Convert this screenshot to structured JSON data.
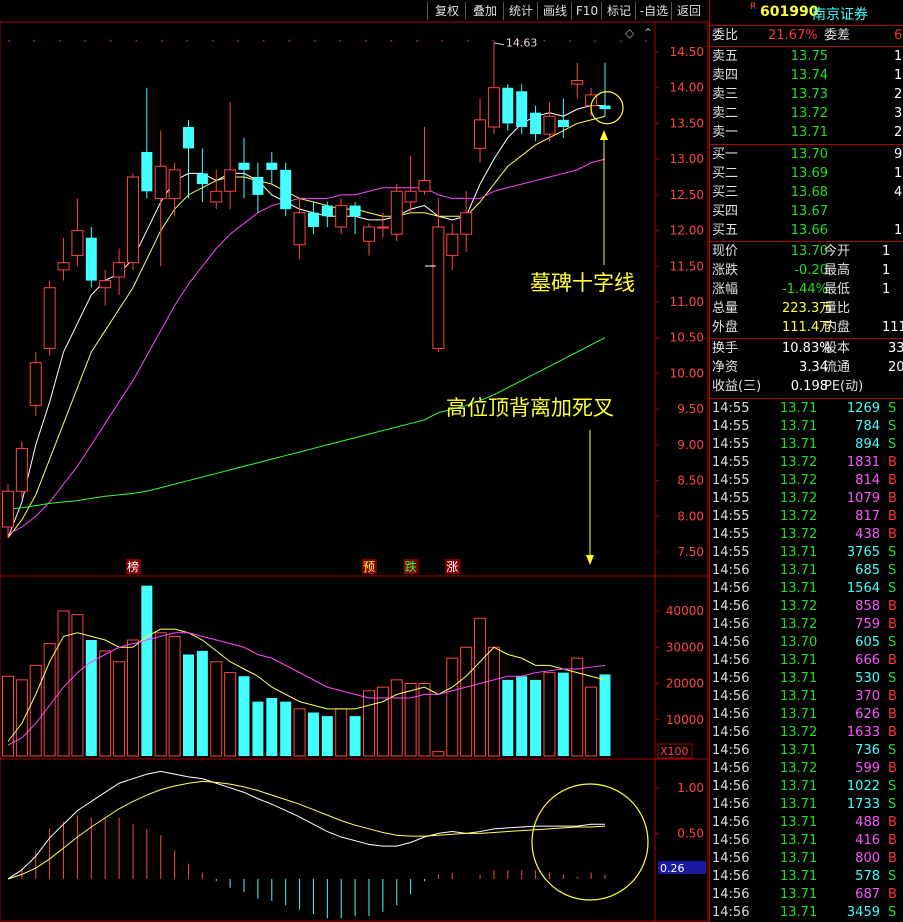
{
  "toolbar": {
    "buttons": [
      "复权",
      "叠加",
      "统计",
      "画线",
      "F10",
      "标记",
      "-自选",
      "返回"
    ]
  },
  "stock": {
    "badge": "R",
    "code": "601990",
    "name": "南京证券"
  },
  "orderbook": {
    "weibi_label": "委比",
    "weibi_value": "21.67%",
    "weicha_label": "委差",
    "weicha_value": "6",
    "asks": [
      {
        "label": "卖五",
        "price": "13.75",
        "vol": "1"
      },
      {
        "label": "卖四",
        "price": "13.74",
        "vol": "1"
      },
      {
        "label": "卖三",
        "price": "13.73",
        "vol": "2"
      },
      {
        "label": "卖二",
        "price": "13.72",
        "vol": "3"
      },
      {
        "label": "卖一",
        "price": "13.71",
        "vol": "2"
      }
    ],
    "bids": [
      {
        "label": "买一",
        "price": "13.70",
        "vol": "9"
      },
      {
        "label": "买二",
        "price": "13.69",
        "vol": "1"
      },
      {
        "label": "买三",
        "price": "13.68",
        "vol": "4"
      },
      {
        "label": "买四",
        "price": "13.67",
        "vol": ""
      },
      {
        "label": "买五",
        "price": "13.66",
        "vol": "1"
      }
    ]
  },
  "quote": [
    {
      "l1": "现价",
      "v1": "13.70",
      "l2": "今开",
      "v2": "1"
    },
    {
      "l1": "涨跌",
      "v1": "-0.20",
      "l2": "最高",
      "v2": "1"
    },
    {
      "l1": "涨幅",
      "v1": "-1.44%",
      "l2": "最低",
      "v2": "1"
    },
    {
      "l1": "总量",
      "v1": "223.3万",
      "l2": "量比",
      "v2": ""
    },
    {
      "l1": "外盘",
      "v1": "111.4万",
      "l2": "内盘",
      "v2": "111"
    }
  ],
  "fund": [
    {
      "l1": "换手",
      "v1": "10.83%",
      "l2": "股本",
      "v2": "33"
    },
    {
      "l1": "净资",
      "v1": "3.34",
      "l2": "流通",
      "v2": "20"
    },
    {
      "l1": "收益(三)",
      "v1": "0.198",
      "l2": "PE(动)",
      "v2": ""
    }
  ],
  "ticks": [
    [
      "14:55",
      "13.71",
      "1269",
      "S"
    ],
    [
      "14:55",
      "13.71",
      "784",
      "S"
    ],
    [
      "14:55",
      "13.71",
      "894",
      "S"
    ],
    [
      "14:55",
      "13.72",
      "1831",
      "B"
    ],
    [
      "14:55",
      "13.72",
      "814",
      "B"
    ],
    [
      "14:55",
      "13.72",
      "1079",
      "B"
    ],
    [
      "14:55",
      "13.72",
      "817",
      "B"
    ],
    [
      "14:55",
      "13.72",
      "438",
      "B"
    ],
    [
      "14:55",
      "13.71",
      "3765",
      "S"
    ],
    [
      "14:56",
      "13.71",
      "685",
      "S"
    ],
    [
      "14:56",
      "13.71",
      "1564",
      "S"
    ],
    [
      "14:56",
      "13.72",
      "858",
      "B"
    ],
    [
      "14:56",
      "13.72",
      "759",
      "B"
    ],
    [
      "14:56",
      "13.70",
      "605",
      "S"
    ],
    [
      "14:56",
      "13.71",
      "666",
      "B"
    ],
    [
      "14:56",
      "13.71",
      "530",
      "S"
    ],
    [
      "14:56",
      "13.71",
      "370",
      "B"
    ],
    [
      "14:56",
      "13.71",
      "626",
      "B"
    ],
    [
      "14:56",
      "13.72",
      "1633",
      "B"
    ],
    [
      "14:56",
      "13.71",
      "736",
      "S"
    ],
    [
      "14:56",
      "13.72",
      "599",
      "B"
    ],
    [
      "14:56",
      "13.71",
      "1022",
      "S"
    ],
    [
      "14:56",
      "13.71",
      "1733",
      "S"
    ],
    [
      "14:56",
      "13.71",
      "488",
      "B"
    ],
    [
      "14:56",
      "13.71",
      "416",
      "B"
    ],
    [
      "14:56",
      "13.71",
      "800",
      "B"
    ],
    [
      "14:56",
      "13.71",
      "578",
      "S"
    ],
    [
      "14:56",
      "13.71",
      "687",
      "B"
    ],
    [
      "14:56",
      "13.71",
      "3459",
      "S"
    ]
  ],
  "chart_data": {
    "type": "candlestick",
    "price_axis": {
      "ylim": [
        7.5,
        14.75
      ],
      "ticks": [
        "14.50",
        "14.00",
        "13.50",
        "13.00",
        "12.50",
        "12.00",
        "11.50",
        "11.00",
        "10.50",
        "10.00",
        "9.50",
        "9.00",
        "8.50",
        "8.00",
        "7.50"
      ]
    },
    "high_marker": "14.63",
    "candles": [
      {
        "o": 7.85,
        "c": 8.35,
        "h": 8.45,
        "l": 7.7
      },
      {
        "o": 8.35,
        "c": 8.95,
        "h": 9.05,
        "l": 8.25
      },
      {
        "o": 9.55,
        "c": 10.15,
        "h": 10.3,
        "l": 9.4
      },
      {
        "o": 10.35,
        "c": 11.2,
        "h": 11.3,
        "l": 10.25
      },
      {
        "o": 11.45,
        "c": 11.55,
        "h": 11.9,
        "l": 11.3
      },
      {
        "o": 11.65,
        "c": 12.0,
        "h": 12.45,
        "l": 11.5
      },
      {
        "o": 11.9,
        "c": 11.3,
        "h": 12.05,
        "l": 11.2
      },
      {
        "o": 11.2,
        "c": 11.3,
        "h": 11.45,
        "l": 10.95
      },
      {
        "o": 11.35,
        "c": 11.55,
        "h": 11.75,
        "l": 11.1
      },
      {
        "o": 11.55,
        "c": 12.75,
        "h": 12.8,
        "l": 11.45
      },
      {
        "o": 13.1,
        "c": 12.55,
        "h": 14.0,
        "l": 12.45
      },
      {
        "o": 12.45,
        "c": 12.9,
        "h": 13.4,
        "l": 11.5
      },
      {
        "o": 12.45,
        "c": 12.85,
        "h": 12.95,
        "l": 12.2
      },
      {
        "o": 13.45,
        "c": 13.15,
        "h": 13.55,
        "l": 12.45
      },
      {
        "o": 12.8,
        "c": 12.65,
        "h": 13.15,
        "l": 12.4
      },
      {
        "o": 12.4,
        "c": 12.55,
        "h": 12.85,
        "l": 12.3
      },
      {
        "o": 12.55,
        "c": 12.85,
        "h": 13.8,
        "l": 12.3
      },
      {
        "o": 12.95,
        "c": 12.85,
        "h": 13.3,
        "l": 12.45
      },
      {
        "o": 12.75,
        "c": 12.5,
        "h": 12.95,
        "l": 12.25
      },
      {
        "o": 12.95,
        "c": 12.85,
        "h": 13.1,
        "l": 12.65
      },
      {
        "o": 12.85,
        "c": 12.3,
        "h": 12.95,
        "l": 12.2
      },
      {
        "o": 11.8,
        "c": 12.25,
        "h": 12.45,
        "l": 11.6
      },
      {
        "o": 12.25,
        "c": 12.05,
        "h": 12.4,
        "l": 11.95
      },
      {
        "o": 12.35,
        "c": 12.2,
        "h": 12.4,
        "l": 12.05
      },
      {
        "o": 12.05,
        "c": 12.35,
        "h": 12.45,
        "l": 11.95
      },
      {
        "o": 12.35,
        "c": 12.2,
        "h": 12.4,
        "l": 11.95
      },
      {
        "o": 11.85,
        "c": 12.05,
        "h": 12.1,
        "l": 11.65
      },
      {
        "o": 12.05,
        "c": 12.05,
        "h": 12.25,
        "l": 11.9
      },
      {
        "o": 11.95,
        "c": 12.55,
        "h": 12.65,
        "l": 11.85
      },
      {
        "o": 12.4,
        "c": 12.55,
        "h": 13.05,
        "l": 12.25
      },
      {
        "o": 12.55,
        "c": 12.7,
        "h": 13.45,
        "l": 12.5
      },
      {
        "o": 10.35,
        "c": 12.05,
        "h": 12.45,
        "l": 10.3
      },
      {
        "o": 11.65,
        "c": 11.95,
        "h": 12.1,
        "l": 11.45
      },
      {
        "o": 11.95,
        "c": 12.25,
        "h": 12.55,
        "l": 11.7
      },
      {
        "o": 13.15,
        "c": 13.55,
        "h": 13.85,
        "l": 12.95
      },
      {
        "o": 13.45,
        "c": 14.0,
        "h": 14.63,
        "l": 13.35
      },
      {
        "o": 14.0,
        "c": 13.5,
        "h": 14.05,
        "l": 13.4
      },
      {
        "o": 13.95,
        "c": 13.45,
        "h": 14.05,
        "l": 13.35
      },
      {
        "o": 13.65,
        "c": 13.35,
        "h": 13.75,
        "l": 13.25
      },
      {
        "o": 13.35,
        "c": 13.6,
        "h": 13.8,
        "l": 13.25
      },
      {
        "o": 13.55,
        "c": 13.45,
        "h": 13.85,
        "l": 13.3
      },
      {
        "o": 14.05,
        "c": 14.1,
        "h": 14.35,
        "l": 13.85
      },
      {
        "o": 13.75,
        "c": 13.9,
        "h": 14.0,
        "l": 13.6
      },
      {
        "o": 13.75,
        "c": 13.7,
        "h": 14.35,
        "l": 13.6
      }
    ],
    "ma_lines": [
      {
        "color": "#ffffff",
        "values": [
          7.7,
          8.2,
          9.0,
          9.6,
          10.3,
          10.7,
          11.1,
          11.3,
          11.4,
          11.6,
          12.0,
          12.4,
          12.7,
          12.8,
          12.8,
          12.7,
          12.8,
          12.8,
          12.7,
          12.5,
          12.4,
          12.3,
          12.25,
          12.2,
          12.2,
          12.2,
          12.15,
          12.15,
          12.2,
          12.3,
          12.35,
          12.2,
          12.15,
          12.2,
          12.65,
          13.0,
          13.3,
          13.5,
          13.6,
          13.65,
          13.6,
          13.7,
          13.75,
          13.75
        ]
      },
      {
        "color": "#ffff55",
        "values": [
          7.7,
          7.95,
          8.3,
          8.8,
          9.3,
          9.8,
          10.3,
          10.6,
          10.9,
          11.2,
          11.6,
          12.0,
          12.3,
          12.5,
          12.6,
          12.7,
          12.75,
          12.75,
          12.7,
          12.65,
          12.55,
          12.45,
          12.4,
          12.35,
          12.3,
          12.3,
          12.25,
          12.2,
          12.2,
          12.25,
          12.25,
          12.2,
          12.2,
          12.2,
          12.4,
          12.65,
          12.9,
          13.05,
          13.2,
          13.3,
          13.4,
          13.5,
          13.55,
          13.6
        ]
      },
      {
        "color": "#ff44ff",
        "values": [
          7.75,
          7.85,
          8.0,
          8.2,
          8.45,
          8.7,
          9.0,
          9.3,
          9.6,
          9.9,
          10.25,
          10.6,
          10.95,
          11.25,
          11.5,
          11.75,
          11.95,
          12.1,
          12.25,
          12.35,
          12.4,
          12.45,
          12.45,
          12.45,
          12.5,
          12.5,
          12.55,
          12.6,
          12.6,
          12.6,
          12.6,
          12.5,
          12.45,
          12.45,
          12.45,
          12.55,
          12.6,
          12.65,
          12.7,
          12.75,
          12.8,
          12.85,
          12.95,
          13.0
        ]
      },
      {
        "color": "#33ff33",
        "values": [
          8.1,
          8.12,
          8.15,
          8.18,
          8.2,
          8.22,
          8.25,
          8.28,
          8.3,
          8.32,
          8.35,
          8.4,
          8.45,
          8.5,
          8.55,
          8.6,
          8.65,
          8.7,
          8.75,
          8.8,
          8.85,
          8.9,
          8.95,
          9.0,
          9.05,
          9.1,
          9.15,
          9.2,
          9.25,
          9.3,
          9.35,
          9.45,
          9.5,
          9.55,
          9.62,
          9.7,
          9.8,
          9.9,
          10.0,
          10.1,
          10.2,
          10.3,
          10.4,
          10.5
        ]
      }
    ],
    "signals": [
      {
        "label": "榜",
        "color": "#ffffff",
        "bg": "#800000",
        "index": 9
      },
      {
        "label": "预",
        "color": "#ffff33",
        "bg": "#800000",
        "index": 26
      },
      {
        "label": "跌",
        "color": "#33ff33",
        "bg": "#800000",
        "index": 29
      },
      {
        "label": "涨",
        "color": "#ffffff",
        "bg": "#800000",
        "index": 32
      }
    ],
    "volume_axis": {
      "ylim": [
        0,
        48000
      ],
      "ticks": [
        "40000",
        "30000",
        "20000",
        "10000"
      ],
      "unit": "X100"
    },
    "volume": [
      22000,
      21000,
      25000,
      31000,
      40000,
      39000,
      32000,
      29000,
      26000,
      32000,
      47000,
      34000,
      33000,
      28000,
      29000,
      26000,
      23000,
      22000,
      15000,
      16000,
      15000,
      13000,
      12000,
      11000,
      13000,
      11000,
      18000,
      19000,
      21000,
      20000,
      20000,
      1200,
      27000,
      30000,
      38000,
      30000,
      21000,
      22000,
      21000,
      23000,
      23000,
      27000,
      19000,
      22500
    ],
    "vol_ma": [
      {
        "color": "#ffff55",
        "values": [
          4000,
          9000,
          17000,
          26000,
          33000,
          34000,
          33000,
          32000,
          30000,
          30000,
          33000,
          35000,
          35000,
          34000,
          32000,
          29000,
          26000,
          24000,
          22000,
          19000,
          17000,
          15000,
          14000,
          13000,
          13000,
          13000,
          14000,
          15000,
          17000,
          18000,
          19000,
          17000,
          19000,
          22000,
          26000,
          30000,
          28000,
          27000,
          25000,
          25000,
          24000,
          23000,
          22000,
          21000
        ]
      },
      {
        "color": "#ff44ff",
        "values": [
          3000,
          5000,
          9000,
          14000,
          19000,
          23000,
          26000,
          28000,
          30000,
          31000,
          32000,
          33000,
          34000,
          34000,
          33000,
          32000,
          31000,
          30000,
          28000,
          27000,
          25000,
          23000,
          21000,
          19000,
          18000,
          17000,
          16000,
          16000,
          16000,
          16000,
          17000,
          17000,
          18000,
          19000,
          20000,
          21000,
          22000,
          22000,
          23000,
          23500,
          24000,
          24000,
          24500,
          25000
        ]
      }
    ],
    "macd_axis": {
      "ylim": [
        -0.45,
        1.25
      ],
      "ticks": [
        "1.00",
        "0.50"
      ],
      "current": "0.26"
    },
    "dif": [
      0.0,
      0.1,
      0.25,
      0.45,
      0.6,
      0.75,
      0.85,
      0.95,
      1.05,
      1.1,
      1.15,
      1.18,
      1.15,
      1.12,
      1.1,
      1.05,
      1.0,
      0.95,
      0.88,
      0.82,
      0.75,
      0.68,
      0.6,
      0.52,
      0.46,
      0.42,
      0.38,
      0.36,
      0.36,
      0.4,
      0.46,
      0.5,
      0.52,
      0.5,
      0.52,
      0.55,
      0.56,
      0.57,
      0.58,
      0.58,
      0.58,
      0.58,
      0.6,
      0.6
    ],
    "dea": [
      0.0,
      0.05,
      0.12,
      0.22,
      0.34,
      0.46,
      0.57,
      0.67,
      0.77,
      0.85,
      0.92,
      0.98,
      1.02,
      1.05,
      1.07,
      1.06,
      1.04,
      1.01,
      0.97,
      0.92,
      0.87,
      0.82,
      0.76,
      0.7,
      0.64,
      0.59,
      0.55,
      0.51,
      0.48,
      0.47,
      0.47,
      0.48,
      0.49,
      0.5,
      0.5,
      0.51,
      0.52,
      0.53,
      0.54,
      0.55,
      0.56,
      0.57,
      0.57,
      0.58
    ],
    "annotations": [
      {
        "text": "墓碑十字线",
        "color": "#ffff33"
      },
      {
        "text": "高位顶背离加死叉",
        "color": "#ffff33"
      }
    ]
  }
}
